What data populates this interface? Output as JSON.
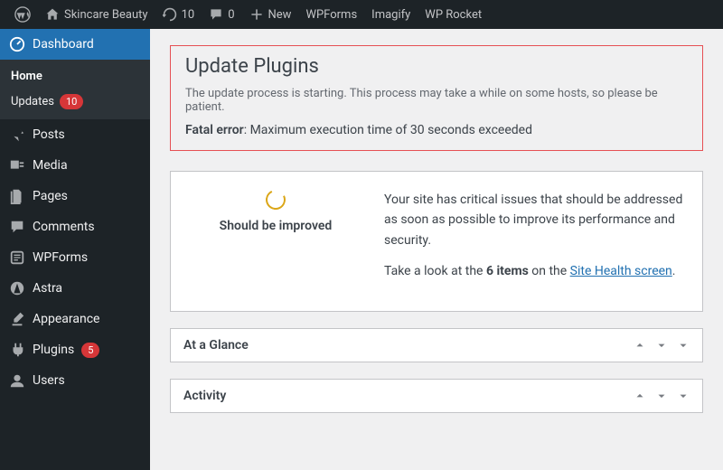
{
  "topbar": {
    "site_name": "Skincare Beauty",
    "updates_count": "10",
    "comments_count": "0",
    "new_label": "New",
    "items": [
      "WPForms",
      "Imagify",
      "WP Rocket"
    ]
  },
  "sidebar": {
    "dashboard": "Dashboard",
    "submenu": {
      "home": "Home",
      "updates": "Updates",
      "updates_count": "10"
    },
    "items": [
      {
        "label": "Posts",
        "icon": "pin"
      },
      {
        "label": "Media",
        "icon": "media"
      },
      {
        "label": "Pages",
        "icon": "page"
      },
      {
        "label": "Comments",
        "icon": "comment"
      },
      {
        "label": "WPForms",
        "icon": "form"
      },
      {
        "label": "Astra",
        "icon": "astra"
      },
      {
        "label": "Appearance",
        "icon": "brush"
      },
      {
        "label": "Plugins",
        "icon": "plug",
        "badge": "5"
      },
      {
        "label": "Users",
        "icon": "user"
      }
    ]
  },
  "error": {
    "title": "Update Plugins",
    "message": "The update process is starting. This process may take a while on some hosts, so please be patient.",
    "fatal_label": "Fatal error",
    "fatal_text": ": Maximum execution time of 30 seconds exceeded"
  },
  "health": {
    "status_label": "Should be improved",
    "text1": "Your site has critical issues that should be addressed as soon as possible to improve its performance and security.",
    "text2a": "Take a look at the ",
    "text2b": "6 items",
    "text2c": " on the ",
    "link": "Site Health screen",
    "text2d": "."
  },
  "panels": {
    "glance": "At a Glance",
    "activity": "Activity"
  }
}
